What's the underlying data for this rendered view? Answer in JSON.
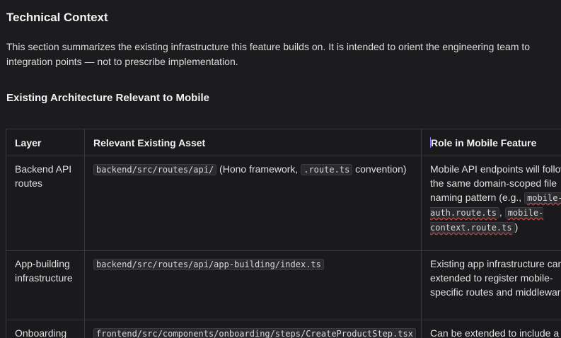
{
  "section": {
    "title": "Technical Context",
    "intro": "This section summarizes the existing infrastructure this feature builds on. It is intended to orient the engineering team to integration points — not to prescribe implementation."
  },
  "subsection": {
    "title": "Existing Architecture Relevant to Mobile"
  },
  "table": {
    "headers": [
      "Layer",
      "Relevant Existing Asset",
      "Role in Mobile Feature"
    ],
    "rows": [
      {
        "layer": "Backend API routes",
        "asset_code_1": "backend/src/routes/api/",
        "asset_text_1": " (Hono framework, ",
        "asset_code_2": ".route.ts",
        "asset_text_2": " convention)",
        "role_text": "Mobile API endpoints will follow the same domain-scoped file naming pattern (e.g., ",
        "role_code_1": "mobile-auth.route.ts",
        "role_sep": ", ",
        "role_code_2": "mobile-context.route.ts",
        "role_end": ")"
      },
      {
        "layer": "App-building infrastructure",
        "asset_code_1": "backend/src/routes/api/app-building/index.ts",
        "role_text": "Existing app infrastructure can be extended to register mobile-specific routes and middleware"
      },
      {
        "layer": "Onboarding",
        "asset_code_1": "frontend/src/components/onboarding/steps/CreateProductStep.tsx",
        "role_text": "Can be extended to include a"
      }
    ]
  }
}
